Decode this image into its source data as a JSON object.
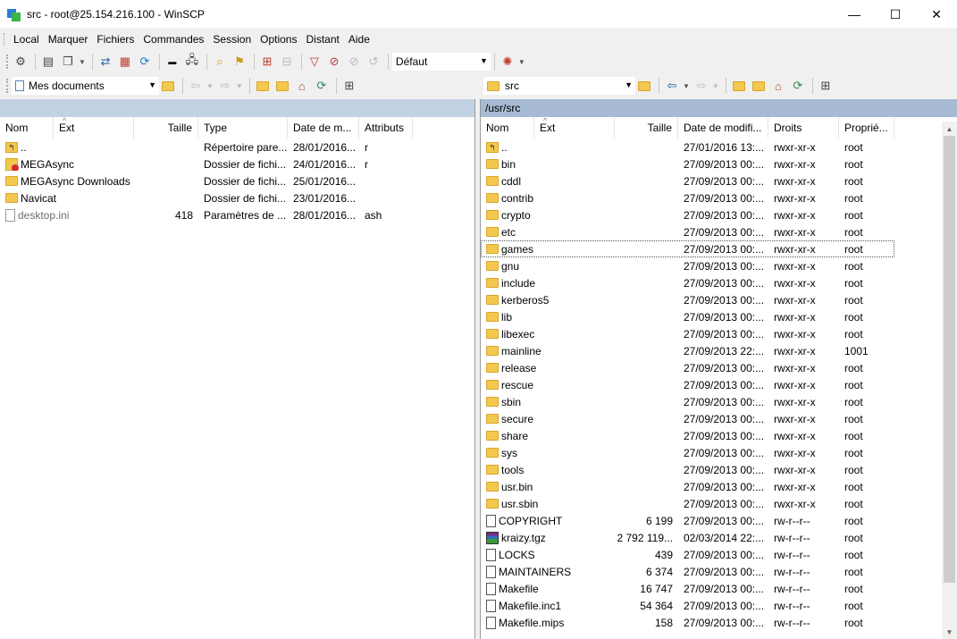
{
  "window": {
    "title": "src - root@25.154.216.100 - WinSCP",
    "minimize": "—",
    "maximize": "☐",
    "close": "✕"
  },
  "menu": [
    "Local",
    "Marquer",
    "Fichiers",
    "Commandes",
    "Session",
    "Options",
    "Distant",
    "Aide"
  ],
  "toolbar": {
    "transfer_profile": "Défaut"
  },
  "left_nav": {
    "location": "Mes documents"
  },
  "right_nav": {
    "location": "src"
  },
  "left_pane": {
    "path": "",
    "columns": {
      "name": "Nom",
      "ext": "Ext",
      "size": "Taille",
      "type": "Type",
      "date": "Date de m...",
      "attrs": "Attributs"
    },
    "rows": [
      {
        "icon": "parent-dir-icon",
        "name": "..",
        "size": "",
        "type": "Répertoire pare...",
        "date": "28/01/2016...",
        "attrs": "r"
      },
      {
        "icon": "megasync-folder-icon",
        "name": "MEGAsync",
        "size": "",
        "type": "Dossier de fichi...",
        "date": "24/01/2016...",
        "attrs": "r"
      },
      {
        "icon": "folder-icon",
        "name": "MEGAsync Downloads",
        "size": "",
        "type": "Dossier de fichi...",
        "date": "25/01/2016...",
        "attrs": ""
      },
      {
        "icon": "folder-icon",
        "name": "Navicat",
        "size": "",
        "type": "Dossier de fichi...",
        "date": "23/01/2016...",
        "attrs": ""
      },
      {
        "icon": "ini-file-icon",
        "name": "desktop.ini",
        "size": "418",
        "type": "Paramètres de ...",
        "date": "28/01/2016...",
        "attrs": "ash",
        "hidden": true
      }
    ]
  },
  "right_pane": {
    "path": "/usr/src",
    "columns": {
      "name": "Nom",
      "ext": "Ext",
      "size": "Taille",
      "date": "Date de modifi...",
      "rights": "Droits",
      "owner": "Proprié..."
    },
    "rows": [
      {
        "icon": "parent-dir-icon",
        "name": "..",
        "size": "",
        "date": "27/01/2016 13:...",
        "rights": "rwxr-xr-x",
        "owner": "root"
      },
      {
        "icon": "folder-icon",
        "name": "bin",
        "size": "",
        "date": "27/09/2013 00:...",
        "rights": "rwxr-xr-x",
        "owner": "root"
      },
      {
        "icon": "folder-icon",
        "name": "cddl",
        "size": "",
        "date": "27/09/2013 00:...",
        "rights": "rwxr-xr-x",
        "owner": "root"
      },
      {
        "icon": "folder-icon",
        "name": "contrib",
        "size": "",
        "date": "27/09/2013 00:...",
        "rights": "rwxr-xr-x",
        "owner": "root"
      },
      {
        "icon": "folder-icon",
        "name": "crypto",
        "size": "",
        "date": "27/09/2013 00:...",
        "rights": "rwxr-xr-x",
        "owner": "root"
      },
      {
        "icon": "folder-icon",
        "name": "etc",
        "size": "",
        "date": "27/09/2013 00:...",
        "rights": "rwxr-xr-x",
        "owner": "root"
      },
      {
        "icon": "folder-icon",
        "name": "games",
        "size": "",
        "date": "27/09/2013 00:...",
        "rights": "rwxr-xr-x",
        "owner": "root",
        "focused": true
      },
      {
        "icon": "folder-icon",
        "name": "gnu",
        "size": "",
        "date": "27/09/2013 00:...",
        "rights": "rwxr-xr-x",
        "owner": "root"
      },
      {
        "icon": "folder-icon",
        "name": "include",
        "size": "",
        "date": "27/09/2013 00:...",
        "rights": "rwxr-xr-x",
        "owner": "root"
      },
      {
        "icon": "folder-icon",
        "name": "kerberos5",
        "size": "",
        "date": "27/09/2013 00:...",
        "rights": "rwxr-xr-x",
        "owner": "root"
      },
      {
        "icon": "folder-icon",
        "name": "lib",
        "size": "",
        "date": "27/09/2013 00:...",
        "rights": "rwxr-xr-x",
        "owner": "root"
      },
      {
        "icon": "folder-icon",
        "name": "libexec",
        "size": "",
        "date": "27/09/2013 00:...",
        "rights": "rwxr-xr-x",
        "owner": "root"
      },
      {
        "icon": "folder-icon",
        "name": "mainline",
        "size": "",
        "date": "27/09/2013 22:...",
        "rights": "rwxr-xr-x",
        "owner": "1001"
      },
      {
        "icon": "folder-icon",
        "name": "release",
        "size": "",
        "date": "27/09/2013 00:...",
        "rights": "rwxr-xr-x",
        "owner": "root"
      },
      {
        "icon": "folder-icon",
        "name": "rescue",
        "size": "",
        "date": "27/09/2013 00:...",
        "rights": "rwxr-xr-x",
        "owner": "root"
      },
      {
        "icon": "folder-icon",
        "name": "sbin",
        "size": "",
        "date": "27/09/2013 00:...",
        "rights": "rwxr-xr-x",
        "owner": "root"
      },
      {
        "icon": "folder-icon",
        "name": "secure",
        "size": "",
        "date": "27/09/2013 00:...",
        "rights": "rwxr-xr-x",
        "owner": "root"
      },
      {
        "icon": "folder-icon",
        "name": "share",
        "size": "",
        "date": "27/09/2013 00:...",
        "rights": "rwxr-xr-x",
        "owner": "root"
      },
      {
        "icon": "folder-icon",
        "name": "sys",
        "size": "",
        "date": "27/09/2013 00:...",
        "rights": "rwxr-xr-x",
        "owner": "root"
      },
      {
        "icon": "folder-icon",
        "name": "tools",
        "size": "",
        "date": "27/09/2013 00:...",
        "rights": "rwxr-xr-x",
        "owner": "root"
      },
      {
        "icon": "folder-icon",
        "name": "usr.bin",
        "size": "",
        "date": "27/09/2013 00:...",
        "rights": "rwxr-xr-x",
        "owner": "root"
      },
      {
        "icon": "folder-icon",
        "name": "usr.sbin",
        "size": "",
        "date": "27/09/2013 00:...",
        "rights": "rwxr-xr-x",
        "owner": "root"
      },
      {
        "icon": "file-icon",
        "name": "COPYRIGHT",
        "size": "6 199",
        "date": "27/09/2013 00:...",
        "rights": "rw-r--r--",
        "owner": "root"
      },
      {
        "icon": "archive-icon",
        "name": "kraizy.tgz",
        "size": "2 792 119...",
        "date": "02/03/2014 22:...",
        "rights": "rw-r--r--",
        "owner": "root"
      },
      {
        "icon": "file-icon",
        "name": "LOCKS",
        "size": "439",
        "date": "27/09/2013 00:...",
        "rights": "rw-r--r--",
        "owner": "root"
      },
      {
        "icon": "file-icon",
        "name": "MAINTAINERS",
        "size": "6 374",
        "date": "27/09/2013 00:...",
        "rights": "rw-r--r--",
        "owner": "root"
      },
      {
        "icon": "file-icon",
        "name": "Makefile",
        "size": "16 747",
        "date": "27/09/2013 00:...",
        "rights": "rw-r--r--",
        "owner": "root"
      },
      {
        "icon": "file-icon",
        "name": "Makefile.inc1",
        "size": "54 364",
        "date": "27/09/2013 00:...",
        "rights": "rw-r--r--",
        "owner": "root"
      },
      {
        "icon": "file-icon",
        "name": "Makefile.mips",
        "size": "158",
        "date": "27/09/2013 00:...",
        "rights": "rw-r--r--",
        "owner": "root"
      }
    ]
  },
  "colors": {
    "active_path_bar": "#a6bad3",
    "inactive_path_bar": "#c3d1e4",
    "folder": "#f3c84f"
  }
}
